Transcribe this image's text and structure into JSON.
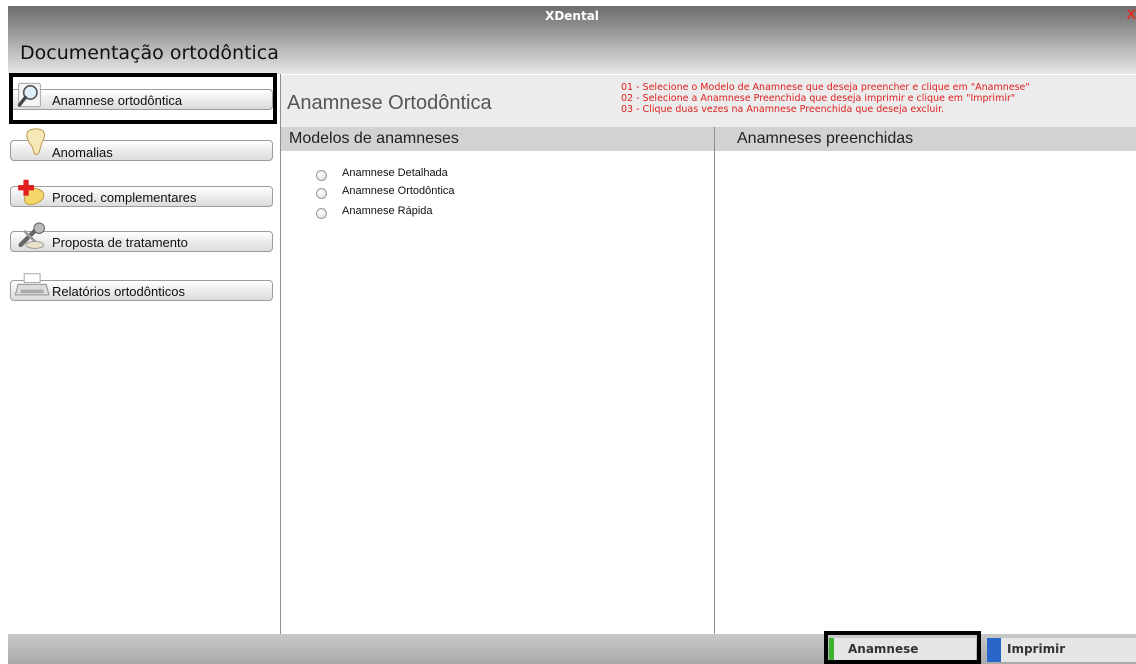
{
  "window": {
    "app_title": "XDental",
    "close_glyph": "X"
  },
  "page_title": "Documentação ortodôntica",
  "sidebar": {
    "items": [
      {
        "label": "Anamnese ortodôntica",
        "icon": "magnifier-icon",
        "selected": true
      },
      {
        "label": "Anomalias",
        "icon": "tooth-icon"
      },
      {
        "label": "Proced. complementares",
        "icon": "plus-tooth-icon"
      },
      {
        "label": "Proposta de tratamento",
        "icon": "tools-icon"
      },
      {
        "label": "Relatórios ortodônticos",
        "icon": "printer-icon"
      }
    ]
  },
  "header": {
    "title": "Anamnese Ortodôntica",
    "instructions": [
      "01 - Selecione o Modelo de Anamnese que deseja preencher e clique em \"Anamnese\"",
      "02 - Selecione a Anamnese Preenchida que deseja imprimir e clique em \"Imprimir\"",
      "03 - Clique duas vezes na Anamnese Preenchida que deseja excluir."
    ]
  },
  "left_panel": {
    "title": "Modelos de anamneses",
    "options": [
      "Anamnese Detalhada",
      "Anamnese Ortodôntica",
      "Anamnese Rápida"
    ]
  },
  "right_panel": {
    "title": "Anamneses preenchidas"
  },
  "bottom_buttons": {
    "anamnese": "Anamnese",
    "imprimir": "Imprimir"
  },
  "colors": {
    "instruction_text": "#e02020",
    "anamnese_accent": "#3bb32f",
    "imprimir_accent": "#2a66c8"
  }
}
